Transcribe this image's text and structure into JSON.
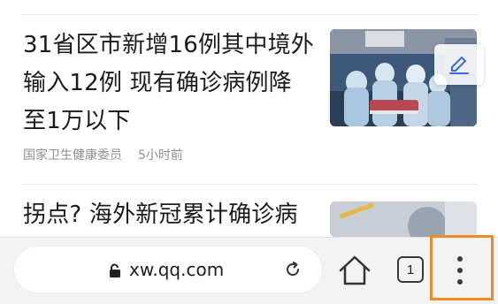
{
  "feed": {
    "items": [
      {
        "headline": "31省区市新增16例其中境外输入12例 现有确诊病例降至1万以下",
        "source": "国家卫生健康委员",
        "time": "5小时前",
        "thumbnail": "medical-workers-photo"
      },
      {
        "headline": "拐点? 海外新冠累计确诊病",
        "thumbnail": "news-photo"
      }
    ]
  },
  "edit_button": {
    "icon": "pencil-icon"
  },
  "browser_toolbar": {
    "url": "xw.qq.com",
    "lock_icon": "lock-icon",
    "reload_icon": "reload-icon",
    "home_icon": "home-icon",
    "tab_count": "1",
    "menu_icon": "more-vertical-icon",
    "highlight_color": "#f08a24"
  }
}
